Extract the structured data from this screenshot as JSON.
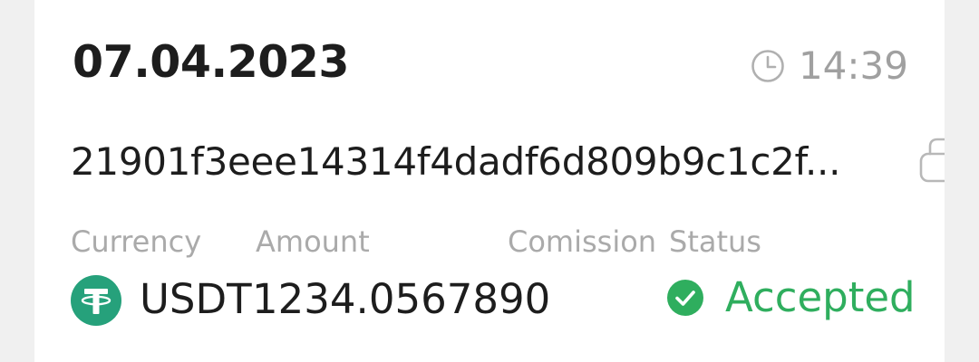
{
  "transaction": {
    "date": "07.04.2023",
    "time": "14:39",
    "hash": "21901f3eee14314f4dadf6d809b9c1c2f..."
  },
  "labels": {
    "currency": "Currency",
    "amount": "Amount",
    "commission": "Comission",
    "status": "Status"
  },
  "values": {
    "currency": "USDT",
    "amount": "1234.0567890",
    "commission": "",
    "status": "Accepted"
  },
  "icons": {
    "clock": "clock-icon",
    "copy": "copy-icon",
    "currency": "tether-icon",
    "status": "check-circle-icon"
  },
  "colors": {
    "status_accepted": "#2fae5e",
    "tether": "#26a17b",
    "muted": "#aaaaaa",
    "text": "#1d1d1d"
  }
}
